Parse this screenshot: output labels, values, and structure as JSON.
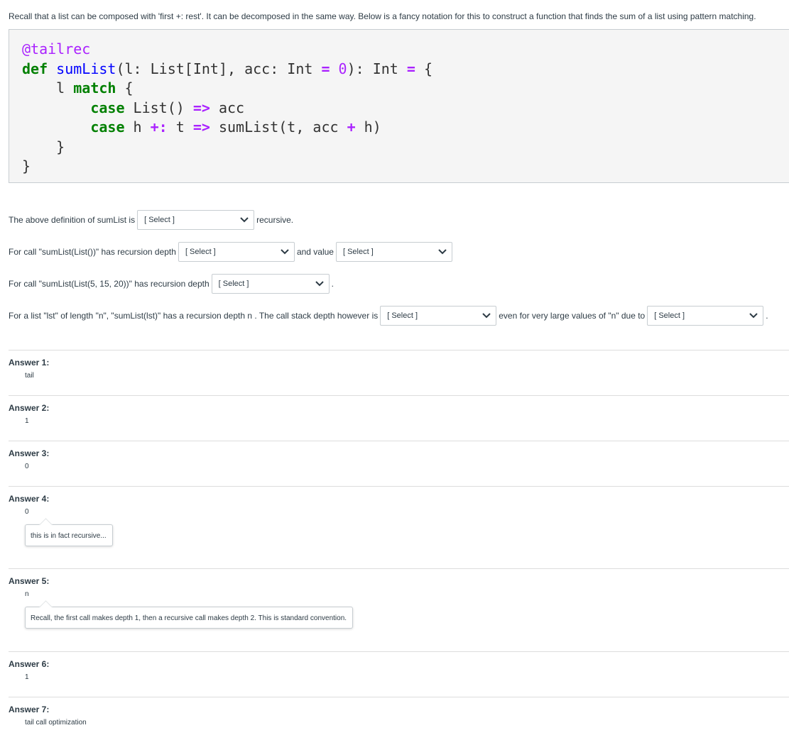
{
  "intro": "Recall that a list can be composed with 'first +: rest'. It can be decomposed in the same way. Below is a fancy notation for this to construct a function that finds the sum of a list using pattern matching.",
  "select_placeholder": "[ Select ]",
  "questions": {
    "q1_before": "The above definition of sumList is",
    "q1_after": "recursive.",
    "q2_before": "For call \"sumList(List())\" has recursion depth",
    "q2_mid": "and value",
    "q3_before": "For call \"sumList(List(5, 15, 20))\" has recursion depth",
    "q3_after": ".",
    "q4_before": "For a list \"lst\" of length \"n\", \"sumList(lst)\" has a recursion depth n . The call stack depth however is",
    "q4_mid": "even for very large values of \"n\" due to",
    "q4_after": "."
  },
  "answers": [
    {
      "label": "Answer 1:",
      "value": "tail"
    },
    {
      "label": "Answer 2:",
      "value": "1"
    },
    {
      "label": "Answer 3:",
      "value": "0"
    },
    {
      "label": "Answer 4:",
      "value": "0",
      "comment": "this is in fact recursive..."
    },
    {
      "label": "Answer 5:",
      "value": "n",
      "comment": "Recall, the first call makes depth 1, then a recursive call makes depth 2. This is standard convention."
    },
    {
      "label": "Answer 6:",
      "value": "1"
    },
    {
      "label": "Answer 7:",
      "value": "tail call optimization"
    }
  ],
  "icons": {
    "dropdown": "chevron-down-icon"
  }
}
